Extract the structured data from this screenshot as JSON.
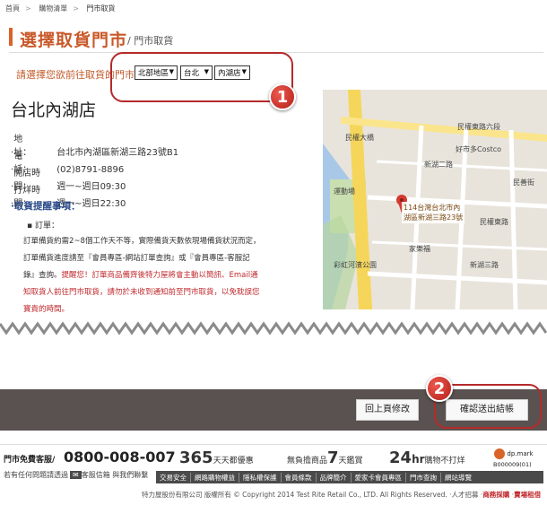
{
  "breadcrumb": [
    "首頁",
    "購物清單",
    "門市取貨"
  ],
  "header": {
    "title": "選擇取貨門市",
    "subtitle": "/ 門市取貨"
  },
  "store_picker": {
    "prompt": "請選擇您欲前往取貨的門市：",
    "region": "北部地區",
    "city": "台北",
    "store": "內湖店"
  },
  "callouts": {
    "one": "1",
    "two": "2"
  },
  "store": {
    "name": "台北內湖店",
    "address_label": "地　　址：",
    "address": "台北市內湖區新湖三路23號B1",
    "phone_label": "電　　話：",
    "phone": "(02)8791-8896",
    "open_label": "開店時間：",
    "open": "週一~週日09:30",
    "close_label": "打烊時間：",
    "close": "週一~週日22:30"
  },
  "reminder": {
    "heading": "取貨提醒事項：",
    "bullet": "訂單：",
    "line1": "訂單備貨約需2~8個工作天不等，實際備貨天數依現場備貨狀況而定，",
    "line2": "訂單備貨進度請至『會員專區-網站訂單查詢』或『會員專區-客服記",
    "line3_plain": "錄』查詢。",
    "line3_red": "提醒您！訂單商品備齊後特力屋將會主動以簡訊、Email通",
    "line4": "知取貨人前往門市取貨，請勿於未收到通知前至門市取貨，以免耽誤您",
    "line5": "寶貴的時間。"
  },
  "map": {
    "popup_line1": "114台灣台北市內",
    "popup_line2": "湖區新湖三路23號",
    "labels": [
      "民權大橋",
      "好市多Costco",
      "運動場",
      "家樂福",
      "彩虹河濱公園",
      "民權東路六段",
      "民善街",
      "民權東路",
      "新湖二路",
      "新湖三路"
    ]
  },
  "actions": {
    "back": "回上頁修改",
    "confirm": "確認送出結帳"
  },
  "footer": {
    "hotline_label": "門市免費客服/",
    "hotline": "0800-008-007",
    "contact_prefix": "若有任何問題請透過",
    "contact_mail": "客服信箱",
    "contact_link": "與我們聯繫",
    "promo1_num": "365",
    "promo1_text": "天天都優惠",
    "promo2_pre": "無負擔商品",
    "promo2_num": "7",
    "promo2_text": "天鑑賞",
    "promo3_num": "24",
    "promo3_unit": "hr",
    "promo3_text": "購物不打烊",
    "dp_name": "dp.mark",
    "dp_code": "B000009(01)",
    "nav": [
      "交易安全",
      "網路購物權益",
      "隱私權保護",
      "會員條款",
      "品牌簡介",
      "愛家卡會員專區",
      "門市查詢",
      "網站導覽"
    ],
    "copyright": "特力屋股份有限公司 版權所有 © Copyright 2014 Test Rite Retail Co., LTD. All Rights Reserved.",
    "jobs": "人才招募",
    "biz": "商務採購",
    "lease": "賣場租借"
  },
  "colors": {
    "accent": "#d9632a",
    "callout": "#b52a2a",
    "bar": "#5a5250"
  }
}
